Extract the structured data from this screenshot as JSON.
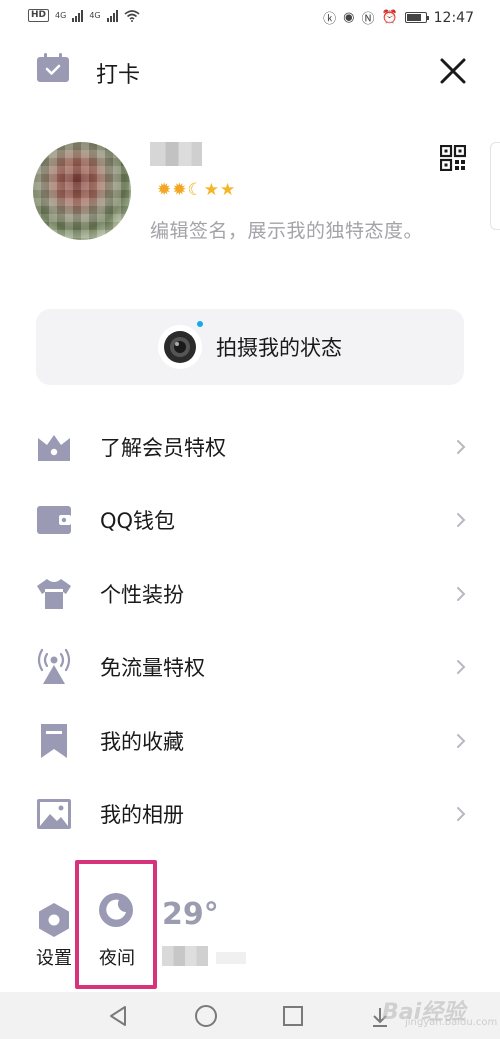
{
  "status_bar": {
    "hd_badge": "HD",
    "network_1": "4G",
    "network_2": "4G",
    "time": "12:47"
  },
  "header": {
    "title": "打卡"
  },
  "profile": {
    "badges": [
      "sun",
      "sun",
      "moon",
      "star",
      "star"
    ],
    "signature_placeholder": "编辑签名，展示我的独特态度。"
  },
  "status_capture": {
    "label": "拍摄我的状态"
  },
  "menu": {
    "items": [
      {
        "label": "了解会员特权",
        "icon": "crown-icon"
      },
      {
        "label": "QQ钱包",
        "icon": "wallet-icon"
      },
      {
        "label": "个性装扮",
        "icon": "tshirt-icon"
      },
      {
        "label": "免流量特权",
        "icon": "signal-tower-icon"
      },
      {
        "label": "我的收藏",
        "icon": "bookmark-icon"
      },
      {
        "label": "我的相册",
        "icon": "photo-icon"
      }
    ]
  },
  "bottom_bar": {
    "settings_label": "设置",
    "night_label": "夜间",
    "temperature": "29°"
  },
  "watermark": {
    "text": "Bai经验",
    "sub": "jingyan.baidu.com"
  },
  "colors": {
    "icon": "#9a9ab4",
    "highlight_box": "#d6337a",
    "card_bg": "#f3f3f5",
    "camera_dot": "#14a8f0"
  }
}
